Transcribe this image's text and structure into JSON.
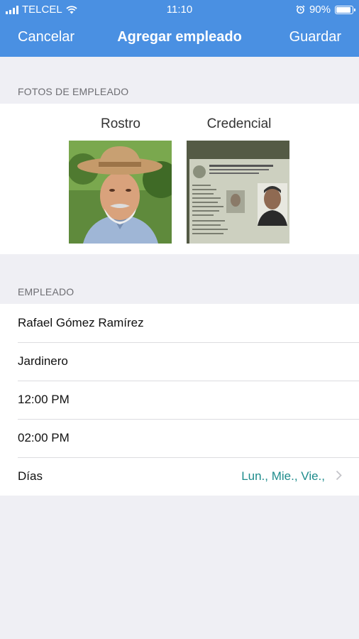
{
  "status_bar": {
    "carrier": "TELCEL",
    "time": "11:10",
    "battery_percent": "90%",
    "battery_level": 0.9,
    "icons": [
      "signal-icon",
      "wifi-icon",
      "alarm-icon",
      "battery-icon"
    ]
  },
  "nav": {
    "cancel_label": "Cancelar",
    "title": "Agregar empleado",
    "save_label": "Guardar"
  },
  "photos_section": {
    "header": "FOTOS DE EMPLEADO",
    "face_label": "Rostro",
    "id_label": "Credencial"
  },
  "employee_section": {
    "header": "EMPLEADO",
    "name": "Rafael Gómez Ramírez",
    "position": "Jardinero",
    "start_time": "12:00 PM",
    "end_time": "02:00 PM",
    "days_label": "Días",
    "days_value": "Lun., Mie., Vie.,"
  },
  "colors": {
    "nav_blue": "#4a90e2",
    "accent_teal": "#1e8c8c",
    "background": "#efeff4"
  }
}
